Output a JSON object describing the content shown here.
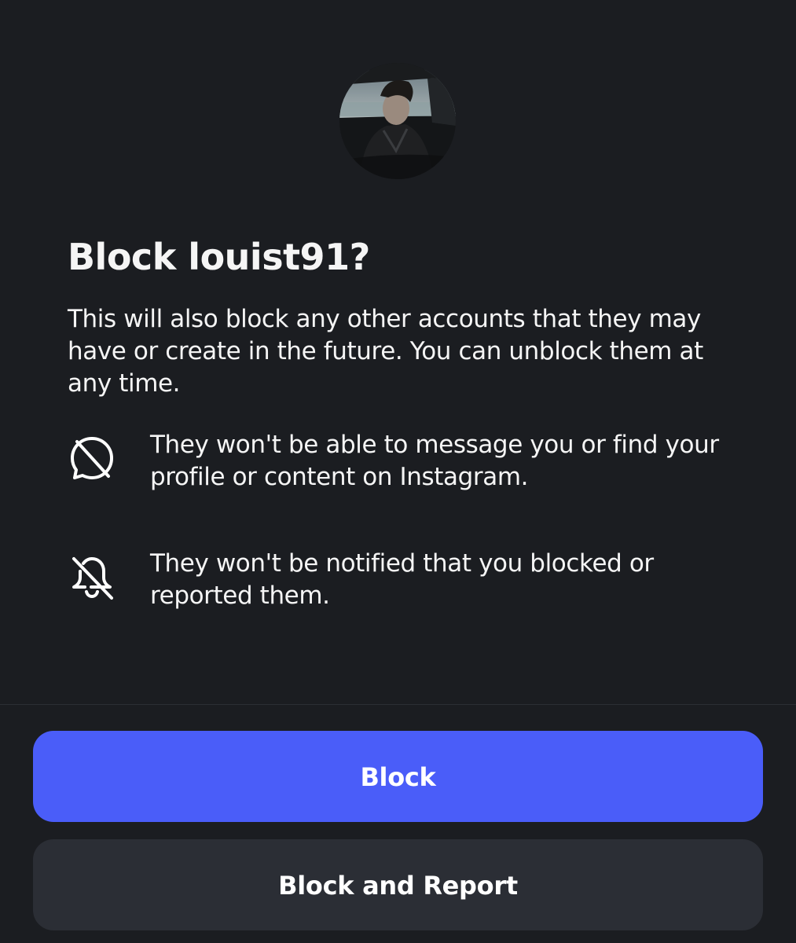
{
  "profile": {
    "avatar_icon": "profile-photo"
  },
  "dialog": {
    "title": "Block louist91?",
    "description": "This will also block any other accounts that they may have or create in the future. You can unblock them at any time.",
    "info": [
      {
        "icon": "message-off-icon",
        "text": "They won't be able to message you or find your profile or content on Instagram."
      },
      {
        "icon": "bell-off-icon",
        "text": "They won't be notified that you blocked or reported them."
      }
    ]
  },
  "actions": {
    "block_label": "Block",
    "block_report_label": "Block and Report"
  },
  "colors": {
    "background": "#1b1d21",
    "primary_button": "#4a5df9",
    "secondary_button": "#2b2e35",
    "text": "#f5f5f5"
  }
}
